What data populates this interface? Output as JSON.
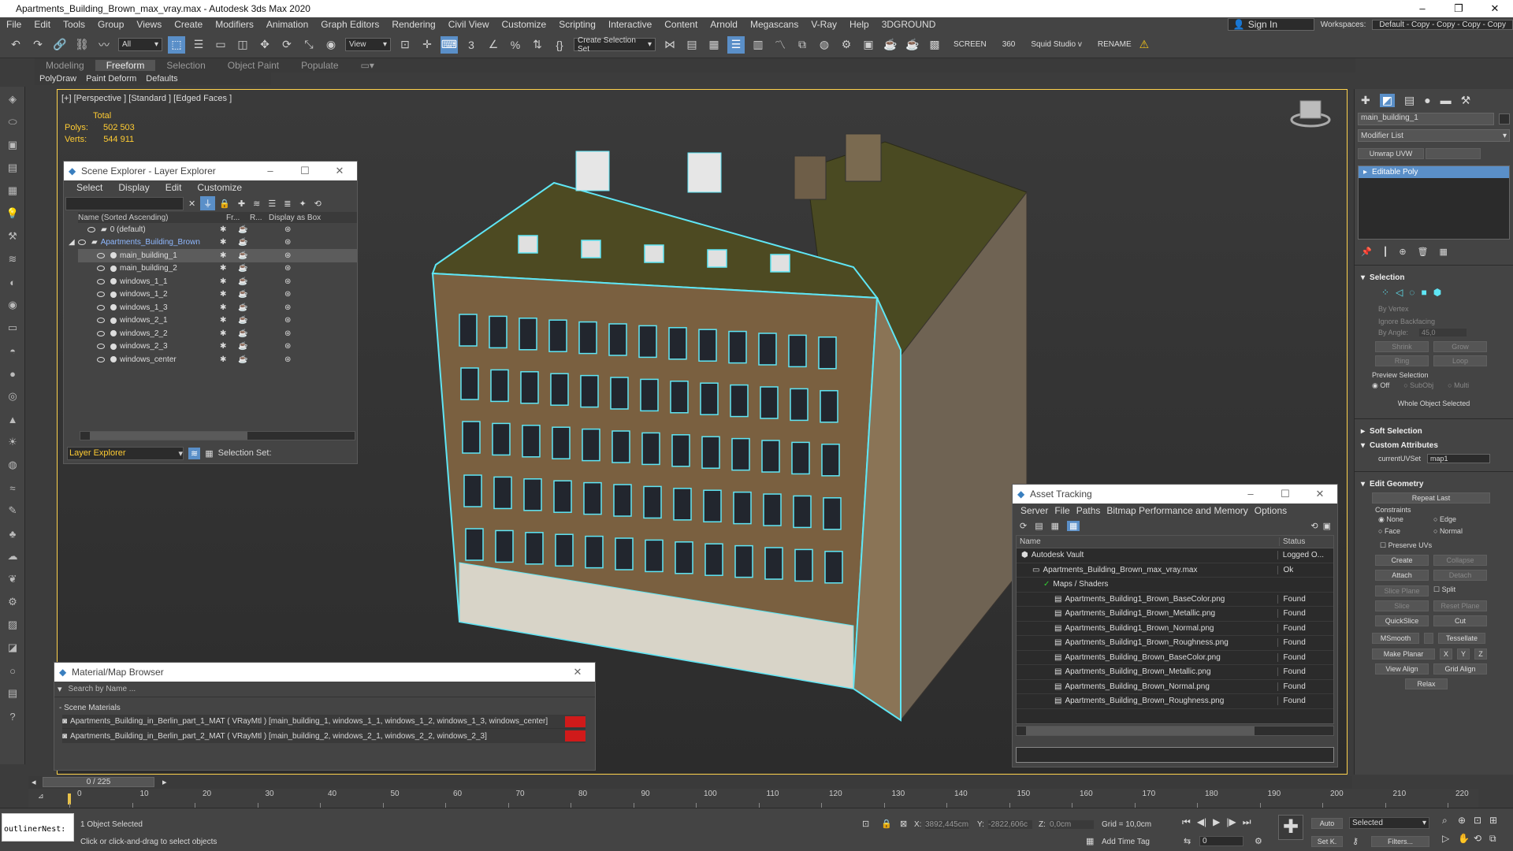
{
  "window": {
    "title": "Apartments_Building_Brown_max_vray.max - Autodesk 3ds Max 2020",
    "min": "–",
    "max": "❐",
    "close": "✕"
  },
  "menu": [
    "File",
    "Edit",
    "Tools",
    "Group",
    "Views",
    "Create",
    "Modifiers",
    "Animation",
    "Graph Editors",
    "Rendering",
    "Civil View",
    "Customize",
    "Scripting",
    "Interactive",
    "Content",
    "Arnold",
    "Megascans",
    "V-Ray",
    "Help",
    "3DGROUND"
  ],
  "account": {
    "sign_in": "Sign In",
    "workspaces_label": "Workspaces:",
    "workspace_value": "Default - Copy - Copy - Copy - Copy"
  },
  "toolbar": {
    "filter": "All",
    "view": "View",
    "selection_set": "Create Selection Set",
    "screen": "SCREEN",
    "n360": "360",
    "squid": "Squid Studio v",
    "rename": "RENAME"
  },
  "ribbon": {
    "tabs": [
      "Modeling",
      "Freeform",
      "Selection",
      "Object Paint",
      "Populate"
    ],
    "sub": [
      "PolyDraw",
      "Paint Deform",
      "Defaults"
    ]
  },
  "viewport": {
    "label": "[+] [Perspective ] [Standard ] [Edged Faces ]",
    "stats": {
      "total": "Total",
      "polys_label": "Polys:",
      "polys": "502 503",
      "verts_label": "Verts:",
      "verts": "544 911"
    }
  },
  "scene_explorer": {
    "title": "Scene Explorer - Layer Explorer",
    "menu": [
      "Select",
      "Display",
      "Edit",
      "Customize"
    ],
    "cols": [
      "Name (Sorted Ascending)",
      "Fr...",
      "R...",
      "Display as Box"
    ],
    "rows": [
      {
        "name": "0 (default)",
        "indent": 1
      },
      {
        "name": "Apartments_Building_Brown",
        "indent": 1,
        "highlight": true
      },
      {
        "name": "main_building_1",
        "indent": 2,
        "selected": true
      },
      {
        "name": "main_building_2",
        "indent": 2
      },
      {
        "name": "windows_1_1",
        "indent": 2
      },
      {
        "name": "windows_1_2",
        "indent": 2
      },
      {
        "name": "windows_1_3",
        "indent": 2
      },
      {
        "name": "windows_2_1",
        "indent": 2
      },
      {
        "name": "windows_2_2",
        "indent": 2
      },
      {
        "name": "windows_2_3",
        "indent": 2
      },
      {
        "name": "windows_center",
        "indent": 2
      }
    ],
    "footer_explorer": "Layer Explorer",
    "footer_selset": "Selection Set:"
  },
  "material_browser": {
    "title": "Material/Map Browser",
    "search_placeholder": "Search by Name ...",
    "section": "- Scene Materials",
    "items": [
      "Apartments_Building_in_Berlin_part_1_MAT  ( VRayMtl )  [main_building_1, windows_1_1, windows_1_2, windows_1_3, windows_center]",
      "Apartments_Building_in_Berlin_part_2_MAT  ( VRayMtl )  [main_building_2, windows_2_1, windows_2_2, windows_2_3]"
    ]
  },
  "asset_tracking": {
    "title": "Asset Tracking",
    "menu": [
      "Server",
      "File",
      "Paths",
      "Bitmap Performance and Memory",
      "Options"
    ],
    "cols": [
      "Name",
      "Status"
    ],
    "rows": [
      {
        "name": "Autodesk Vault",
        "status": "Logged O...",
        "indent": 0
      },
      {
        "name": "Apartments_Building_Brown_max_vray.max",
        "status": "Ok",
        "indent": 1
      },
      {
        "name": "Maps / Shaders",
        "status": "",
        "indent": 2
      },
      {
        "name": "Apartments_Building1_Brown_BaseColor.png",
        "status": "Found",
        "indent": 3
      },
      {
        "name": "Apartments_Building1_Brown_Metallic.png",
        "status": "Found",
        "indent": 3
      },
      {
        "name": "Apartments_Building1_Brown_Normal.png",
        "status": "Found",
        "indent": 3
      },
      {
        "name": "Apartments_Building1_Brown_Roughness.png",
        "status": "Found",
        "indent": 3
      },
      {
        "name": "Apartments_Building_Brown_BaseColor.png",
        "status": "Found",
        "indent": 3
      },
      {
        "name": "Apartments_Building_Brown_Metallic.png",
        "status": "Found",
        "indent": 3
      },
      {
        "name": "Apartments_Building_Brown_Normal.png",
        "status": "Found",
        "indent": 3
      },
      {
        "name": "Apartments_Building_Brown_Roughness.png",
        "status": "Found",
        "indent": 3
      }
    ]
  },
  "command_panel": {
    "object_name": "main_building_1",
    "modifier_list": "Modifier List",
    "unwrap": "Unwrap UVW",
    "stack_item": "Editable Poly",
    "selection": {
      "head": "Selection",
      "by_vertex": "By Vertex",
      "ignore_backfacing": "Ignore Backfacing",
      "by_angle": "By Angle:",
      "angle": "45,0",
      "shrink": "Shrink",
      "grow": "Grow",
      "ring": "Ring",
      "loop": "Loop",
      "preview": "Preview Selection",
      "off": "Off",
      "subobj": "SubObj",
      "multi": "Multi",
      "whole": "Whole Object Selected"
    },
    "soft_selection": "Soft Selection",
    "custom_attributes": "Custom Attributes",
    "current_uvset_label": "currentUVSet",
    "current_uvset": "map1",
    "edit_geometry": {
      "head": "Edit Geometry",
      "repeat_last": "Repeat Last",
      "constraints": "Constraints",
      "none": "None",
      "edge": "Edge",
      "face": "Face",
      "normal": "Normal",
      "preserve": "Preserve UVs",
      "create": "Create",
      "collapse": "Collapse",
      "attach": "Attach",
      "detach": "Detach",
      "slice_plane": "Slice Plane",
      "split": "Split",
      "slice": "Slice",
      "reset_plane": "Reset Plane",
      "quickslice": "QuickSlice",
      "cut": "Cut",
      "msmooth": "MSmooth",
      "tessellate": "Tessellate",
      "make_planar": "Make Planar",
      "x": "X",
      "y": "Y",
      "z": "Z",
      "view_align": "View Align",
      "grid_align": "Grid Align",
      "relax": "Relax"
    }
  },
  "timeline": {
    "frame": "0 / 225",
    "ticks": [
      "0",
      "10",
      "20",
      "30",
      "40",
      "50",
      "60",
      "70",
      "80",
      "90",
      "100",
      "110",
      "120",
      "130",
      "140",
      "150",
      "160",
      "170",
      "180",
      "190",
      "200",
      "210",
      "220"
    ]
  },
  "status": {
    "script": "outlinerNest:",
    "selected": "1 Object Selected",
    "hint": "Click or click-and-drag to select objects",
    "x_label": "X:",
    "x": "3892,445cm",
    "y_label": "Y:",
    "y": "-2822,606c",
    "z_label": "Z:",
    "z": "0,0cm",
    "grid": "Grid = 10,0cm",
    "add_time_tag": "Add Time Tag",
    "auto": "Auto",
    "set_k": "Set K.",
    "selected_dd": "Selected",
    "filters": "Filters...",
    "frame_value": "0"
  },
  "colors": {
    "accent": "#5a8fc8",
    "highlight": "#ffd34d",
    "wire": "#5fe6f5"
  }
}
